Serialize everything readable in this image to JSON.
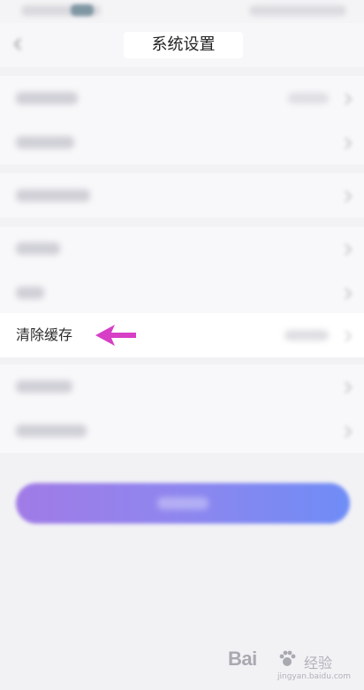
{
  "header": {
    "title": "系统设置"
  },
  "rows": [
    {
      "label": ""
    },
    {
      "label": ""
    },
    {
      "label": ""
    },
    {
      "label": ""
    },
    {
      "label": ""
    },
    {
      "label": "清除缓存"
    },
    {
      "label": ""
    },
    {
      "label": ""
    }
  ],
  "icons": {
    "back": "chevron-left-icon",
    "row_arrow": "chevron-right-icon",
    "annotation": "arrow-left-icon",
    "watermark": "baidu-paw-icon"
  },
  "colors": {
    "annotation_arrow": "#d63fc6",
    "logout_gradient_start": "#a07be6",
    "logout_gradient_end": "#6f8cf6"
  },
  "watermark": {
    "brand": "Bai",
    "brand_suffix": "经验",
    "url": "jingyan.baidu.com"
  }
}
